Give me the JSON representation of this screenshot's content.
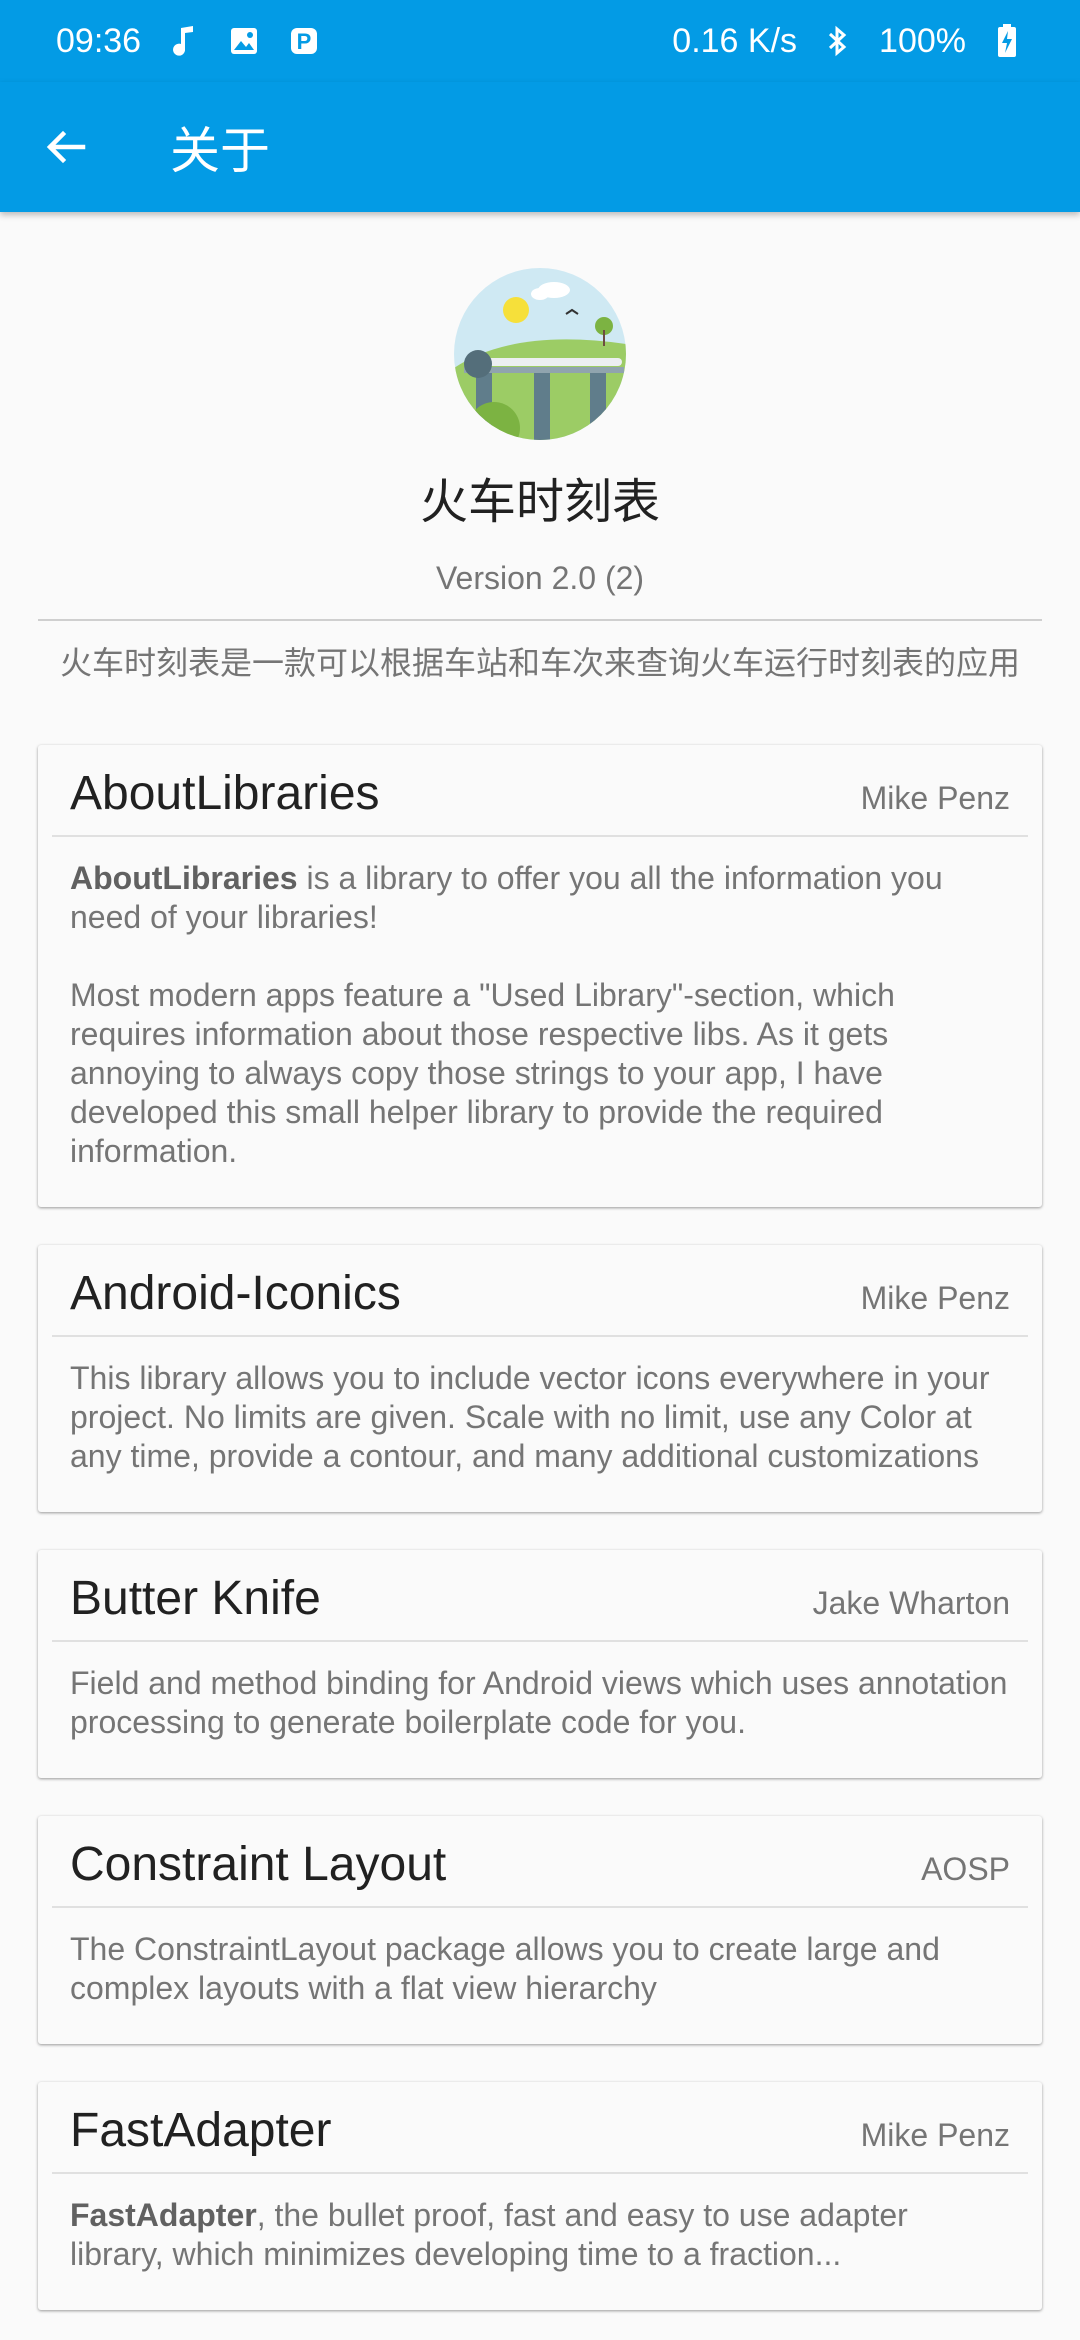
{
  "status": {
    "time": "09:36",
    "net_speed": "0.16 K/s",
    "battery": "100%",
    "icons": [
      "music-note-icon",
      "image-icon",
      "parking-icon",
      "bluetooth-icon",
      "battery-charging-icon"
    ]
  },
  "appbar": {
    "title": "关于"
  },
  "colors": {
    "primary": "#039be5",
    "background": "#fafafa",
    "secondary_text": "#757575"
  },
  "header": {
    "app_name": "火车时刻表",
    "version": "Version 2.0 (2)",
    "description": "火车时刻表是一款可以根据车站和车次来查询火车运行时刻表的应用"
  },
  "libraries": [
    {
      "name": "AboutLibraries",
      "author": "Mike Penz",
      "desc_bold": "AboutLibraries",
      "desc_rest": " is a library to offer you all the information you need of your libraries!",
      "desc_para2": "Most modern apps feature a \"Used Library\"-section, which requires information about those respective libs. As it gets annoying to always copy those strings to your app, I have developed this small helper library to provide the required information."
    },
    {
      "name": "Android-Iconics",
      "author": "Mike Penz",
      "desc": "This library allows you to include vector icons everywhere in your project. No limits are given. Scale with no limit, use any Color at any time, provide a contour, and many additional customizations"
    },
    {
      "name": "Butter Knife",
      "author": "Jake Wharton",
      "desc": "Field and method binding for Android views which uses annotation processing to generate boilerplate code for you."
    },
    {
      "name": "Constraint Layout",
      "author": "AOSP",
      "desc": "The ConstraintLayout package allows you to create large and complex layouts with a flat view hierarchy"
    },
    {
      "name": "FastAdapter",
      "author": "Mike Penz",
      "desc_bold": "FastAdapter",
      "desc_rest": ", the bullet proof, fast and easy to use adapter library, which minimizes developing time to a fraction..."
    }
  ]
}
